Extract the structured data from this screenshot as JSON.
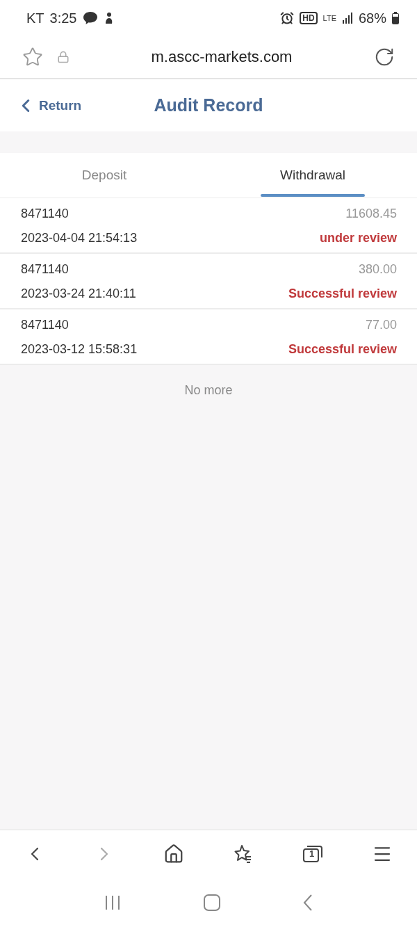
{
  "status_bar": {
    "carrier": "KT",
    "time": "3:25",
    "hd": "HD",
    "network": "LTE",
    "battery": "68%"
  },
  "address_bar": {
    "url": "m.ascc-markets.com"
  },
  "header": {
    "back": "Return",
    "title": "Audit Record"
  },
  "tabs": [
    {
      "label": "Deposit",
      "selected": false
    },
    {
      "label": "Withdrawal",
      "selected": true
    }
  ],
  "records": [
    {
      "account": "8471140",
      "amount": "11608.45",
      "time": "2023-04-04 21:54:13",
      "status": "under review"
    },
    {
      "account": "8471140",
      "amount": "380.00",
      "time": "2023-03-24 21:40:11",
      "status": "Successful review"
    },
    {
      "account": "8471140",
      "amount": "77.00",
      "time": "2023-03-12 15:58:31",
      "status": "Successful review"
    }
  ],
  "footer_note": "No more",
  "toolbar": [
    {
      "kind": "back",
      "disabled": false
    },
    {
      "kind": "forward",
      "disabled": true
    },
    {
      "kind": "home",
      "disabled": false
    },
    {
      "kind": "bookmarks",
      "disabled": false
    },
    {
      "kind": "tabs",
      "disabled": false,
      "count": "1"
    },
    {
      "kind": "menu",
      "disabled": false
    }
  ]
}
